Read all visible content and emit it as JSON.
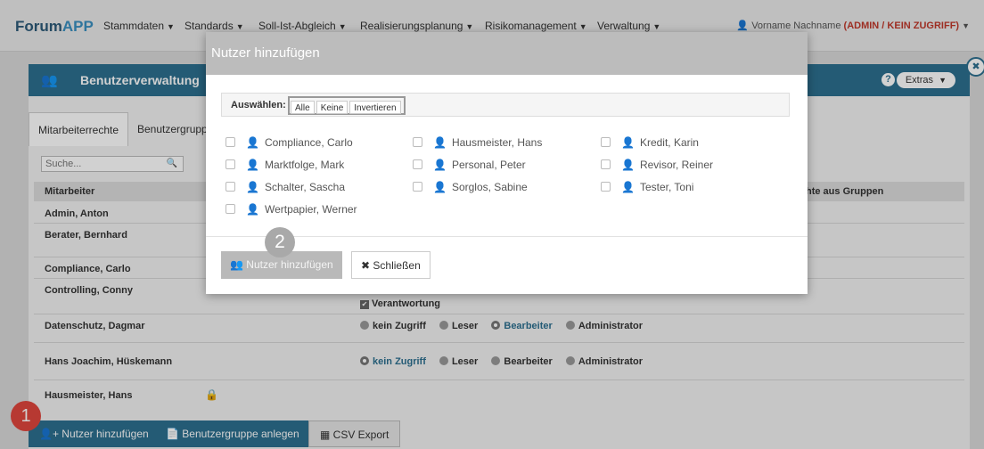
{
  "brand": {
    "forum": "Forum",
    "app": "APP"
  },
  "nav": [
    "Stammdaten",
    "Standards",
    "Soll-Ist-Abgleich",
    "Realisierungsplanung",
    "Risikomanagement",
    "Verwaltung"
  ],
  "user": {
    "name": "Vorname Nachname",
    "role": "(ADMIN / KEIN ZUGRIFF)"
  },
  "panel": {
    "title": "Benutzerverwaltung",
    "help": "?",
    "extras": "Extras"
  },
  "tabs": [
    "Mitarbeiterrechte",
    "Benutzergrupp"
  ],
  "search": {
    "placeholder": "Suche..."
  },
  "table": {
    "header_employee": "Mitarbeiter",
    "header_rights": "hte aus Gruppen",
    "rows": [
      "Admin, Anton",
      "Berater, Bernhard",
      "Compliance, Carlo",
      "Controlling, Conny",
      "Datenschutz, Dagmar",
      "Hans Joachim, Hüskemann",
      "Hausmeister, Hans"
    ],
    "options": [
      "kein Zugriff",
      "Leser",
      "Bearbeiter",
      "Administrator"
    ],
    "verantwortung": "Verantwortung"
  },
  "bottom": {
    "add_user": "Nutzer hinzufügen",
    "add_group": "Benutzergruppe anlegen",
    "csv": "CSV Export"
  },
  "badges": {
    "one": "1",
    "two": "2"
  },
  "modal": {
    "title": "Nutzer hinzufügen",
    "select_label": "Auswählen:",
    "select_buttons": [
      "Alle",
      "Keine",
      "Invertieren"
    ],
    "users": [
      "Compliance, Carlo",
      "Hausmeister, Hans",
      "Kredit, Karin",
      "Marktfolge, Mark",
      "Personal, Peter",
      "Revisor, Reiner",
      "Schalter, Sascha",
      "Sorglos, Sabine",
      "Tester, Toni",
      "Wertpapier, Werner"
    ],
    "add_button": "Nutzer hinzufügen",
    "close_button": "Schließen"
  },
  "colors": {
    "accent": "#2c6f8f",
    "badge_red": "#e0463d",
    "role_red": "#c0392b"
  }
}
